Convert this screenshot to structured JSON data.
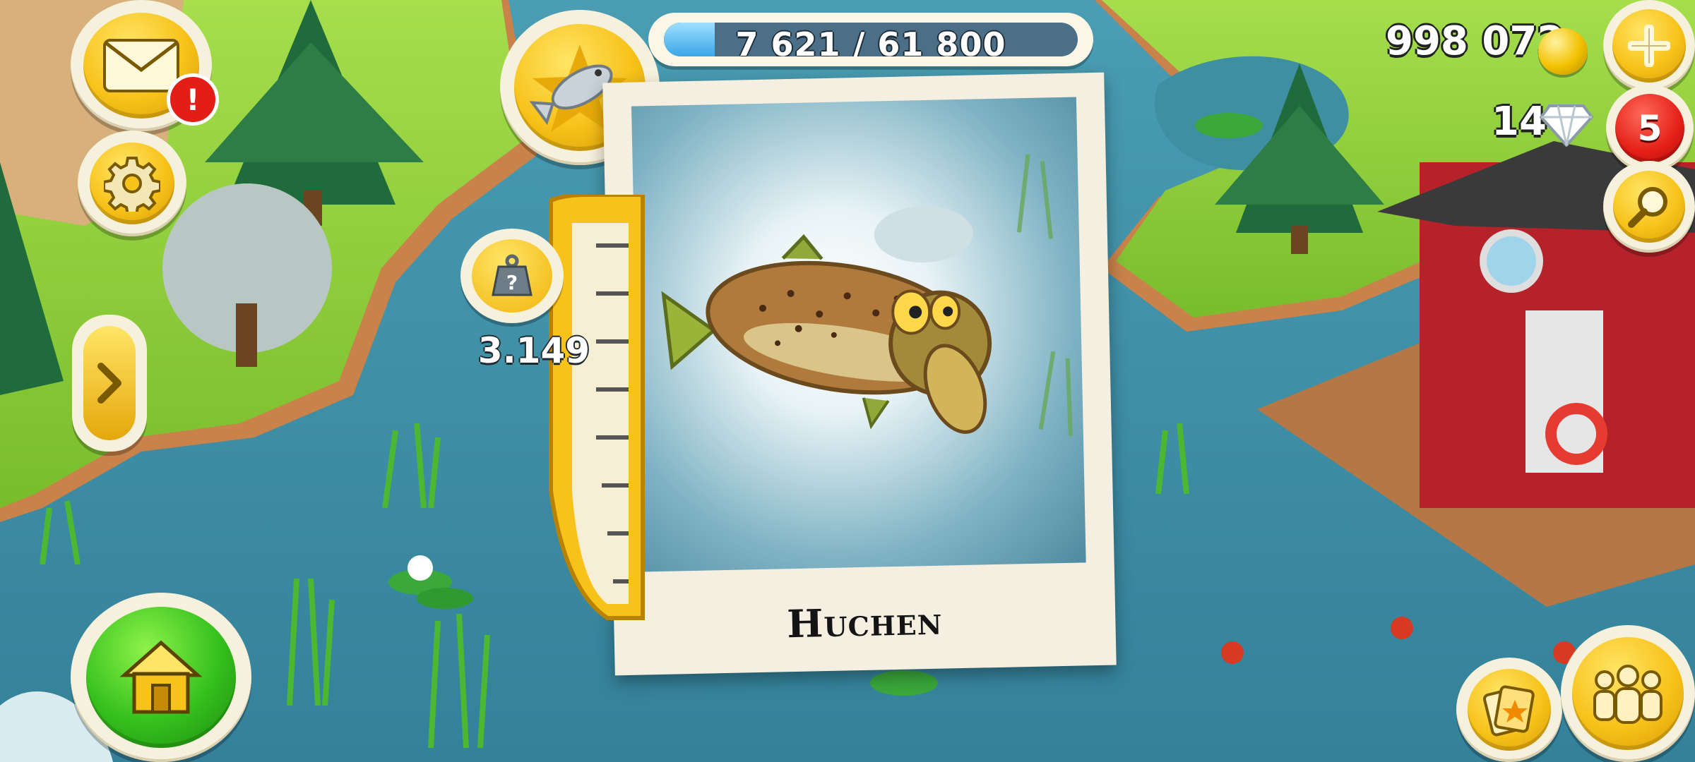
{
  "top_bar": {
    "xp_text": "7 621 / 61 800",
    "xp_progress": 0.123
  },
  "currency": {
    "coins": "998 072",
    "diamonds": "14",
    "notifications": "5"
  },
  "fish_card": {
    "name": "Huchen",
    "weight": "3.149"
  },
  "icons": {
    "mail": "envelope-icon",
    "settings": "gear-icon",
    "expand": "chevron-right-icon",
    "home": "house-icon",
    "add": "plus-icon",
    "search": "magnifier-icon",
    "friends": "people-icon",
    "cards": "card-icon",
    "fish_badge": "fish-icon",
    "weight": "weight-icon"
  },
  "colors": {
    "xp_fill": "#3aa6e8",
    "button_yellow": "#f7c21a",
    "button_green": "#35c01d",
    "badge_red": "#e31e17",
    "water": "#3f8fa3",
    "grass": "#8fd13a"
  }
}
